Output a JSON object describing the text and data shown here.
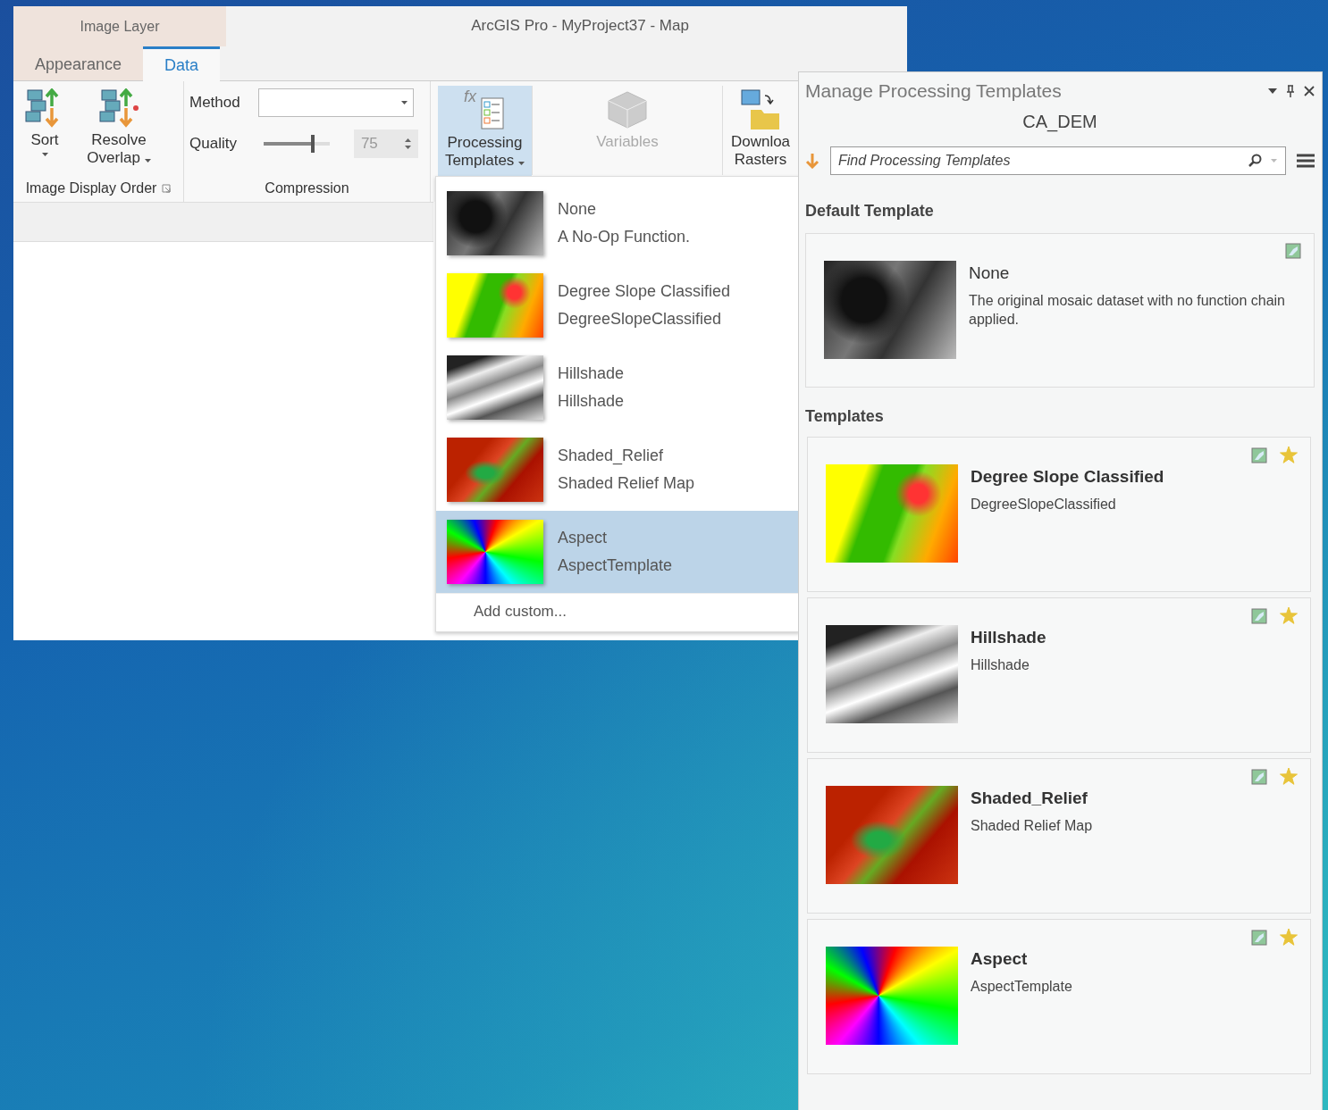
{
  "window": {
    "title": "ArcGIS Pro - MyProject37 - Map",
    "contextual_tab": "Image Layer"
  },
  "tabs": [
    {
      "label": "Appearance",
      "selected": false
    },
    {
      "label": "Data",
      "selected": true
    }
  ],
  "ribbon": {
    "display_order": {
      "label": "Image Display Order",
      "sort": "Sort",
      "resolve": "Resolve Overlap"
    },
    "compression": {
      "label": "Compression",
      "method_label": "Method",
      "quality": {
        "label": "Quality",
        "level": 0.75,
        "value": "75"
      }
    },
    "processing_templates": {
      "label": "Processing Templates",
      "icon_text": "fx",
      "selected": true
    },
    "variables": {
      "label": "Variables",
      "disabled": true
    },
    "download": {
      "label": "Downloa Rasters"
    }
  },
  "template_menu": {
    "items": [
      {
        "name": "None",
        "description": "A No-Op Function.",
        "kind": "gray",
        "selected": false
      },
      {
        "name": "Degree Slope Classified",
        "description": "DegreeSlopeClassified",
        "kind": "slope",
        "selected": false
      },
      {
        "name": "Hillshade",
        "description": "Hillshade",
        "kind": "hillshade",
        "selected": false
      },
      {
        "name": "Shaded_Relief",
        "description": "Shaded Relief Map",
        "kind": "relief",
        "selected": false
      },
      {
        "name": "Aspect",
        "description": "AspectTemplate",
        "kind": "aspect",
        "selected": true
      }
    ],
    "add_custom": "Add custom..."
  },
  "pane": {
    "title": "Manage Processing Templates",
    "layer": "CA_DEM",
    "search": {
      "placeholder": "Find Processing Templates"
    },
    "default_section": "Default Template",
    "default_template": {
      "name": "None",
      "description": "The original mosaic dataset with no function chain applied.",
      "kind": "gray"
    },
    "templates_section": "Templates",
    "templates": [
      {
        "name": "Degree Slope Classified",
        "description": "DegreeSlopeClassified",
        "kind": "slope",
        "favorite": true
      },
      {
        "name": "Hillshade",
        "description": "Hillshade",
        "kind": "hillshade",
        "favorite": true
      },
      {
        "name": "Shaded_Relief",
        "description": "Shaded Relief Map",
        "kind": "relief",
        "favorite": true
      },
      {
        "name": "Aspect",
        "description": "AspectTemplate",
        "kind": "aspect",
        "favorite": true
      }
    ]
  }
}
